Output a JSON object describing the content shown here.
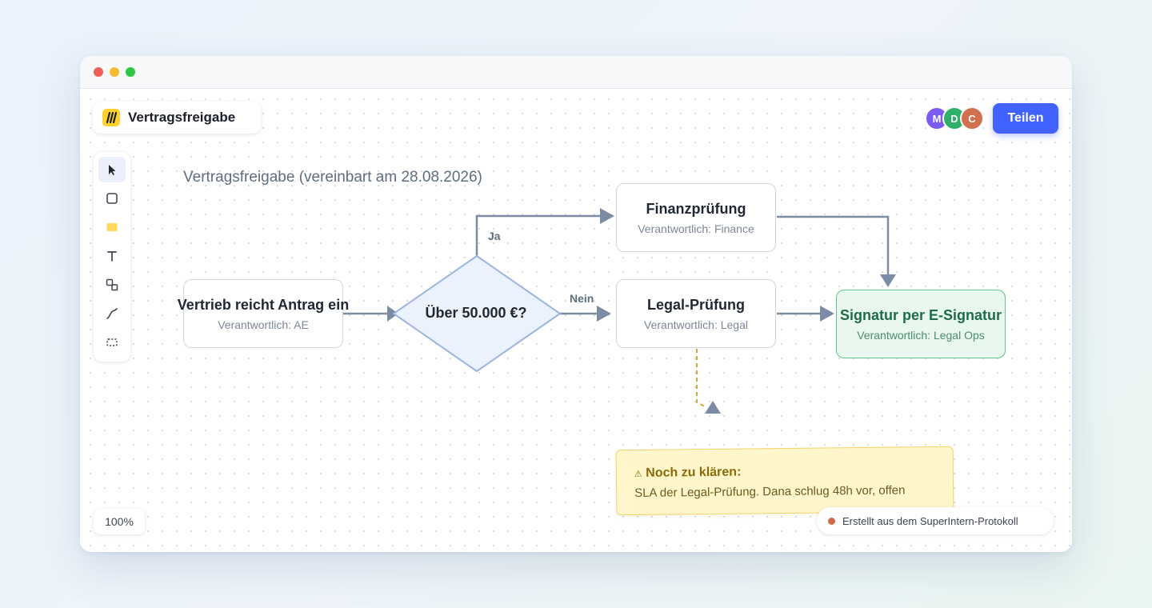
{
  "window": {
    "controls": [
      "close",
      "minimize",
      "maximize"
    ]
  },
  "board": {
    "name": "Vertragsfreigabe",
    "logo": "miro-logo-icon",
    "logo_color": "#ffd02f"
  },
  "toolbar": {
    "tools": [
      {
        "name": "select-tool",
        "icon": "cursor-icon",
        "active": true
      },
      {
        "name": "shape-tool",
        "icon": "square-icon"
      },
      {
        "name": "sticky-note-tool",
        "icon": "sticky-note-icon"
      },
      {
        "name": "text-tool",
        "icon": "text-icon"
      },
      {
        "name": "shapes-tool",
        "icon": "shapes-icon"
      },
      {
        "name": "pen-tool",
        "icon": "pen-icon"
      },
      {
        "name": "frame-tool",
        "icon": "frame-icon"
      }
    ]
  },
  "collaborators": [
    {
      "initial": "M",
      "color": "#7b5cf0"
    },
    {
      "initial": "D",
      "color": "#2eaf6a"
    },
    {
      "initial": "C",
      "color": "#d0704e"
    }
  ],
  "share": {
    "label": "Teilen",
    "color": "#4262ff"
  },
  "diagram": {
    "heading": "Vertragsfreigabe (vereinbart am 28.08.2026)",
    "nodes": {
      "start": {
        "title": "Vertrieb reicht Antrag ein",
        "subtitle": "Verantwortlich: AE"
      },
      "decision": {
        "title": "Über 50.000 €?"
      },
      "finance": {
        "title": "Finanzprüfung",
        "subtitle": "Verantwortlich: Finance"
      },
      "legal": {
        "title": "Legal-Prüfung",
        "subtitle": "Verantwortlich: Legal"
      },
      "signature": {
        "title": "Signatur per E-Signatur",
        "subtitle": "Verantwortlich: Legal Ops"
      }
    },
    "edge_labels": {
      "yes": "Ja",
      "no": "Nein"
    }
  },
  "note": {
    "icon": "⚠",
    "title": "Noch zu klären:",
    "text": "SLA der Legal-Prüfung. Dana schlug 48h vor, offen"
  },
  "zoom": {
    "level": "100%"
  },
  "source": {
    "label": "Erstellt aus dem SuperIntern-Protokoll",
    "dot_color": "#cf6a48"
  }
}
